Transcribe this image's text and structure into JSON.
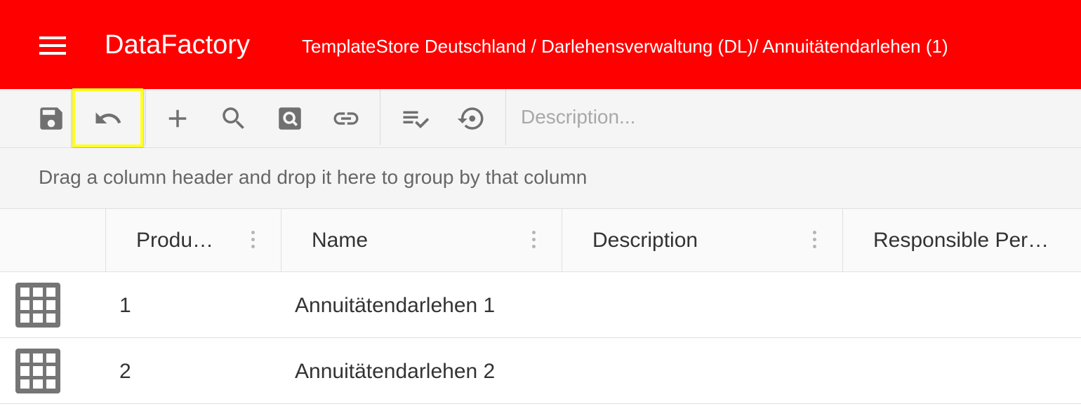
{
  "appbar": {
    "title": "DataFactory",
    "breadcrumb": "TemplateStore Deutschland / Darlehensverwaltung (DL)/ Annuitätendarlehen (1)",
    "background_color": "#ff0000",
    "menu_icon": "hamburger-menu-icon"
  },
  "toolbar": {
    "buttons": [
      {
        "name": "save",
        "icon": "save-icon"
      },
      {
        "name": "undo",
        "icon": "undo-icon",
        "highlighted": true
      },
      {
        "name": "add",
        "icon": "plus-icon"
      },
      {
        "name": "search",
        "icon": "search-icon"
      },
      {
        "name": "search-record",
        "icon": "image-search-icon"
      },
      {
        "name": "link",
        "icon": "link-icon"
      },
      {
        "name": "validate",
        "icon": "playlist-check-icon"
      },
      {
        "name": "restore",
        "icon": "history-icon"
      }
    ],
    "description_placeholder": "Description...",
    "description_value": "",
    "highlight_color": "#ffff22"
  },
  "grid": {
    "group_panel_text": "Drag a column header and drop it here to group by that column",
    "columns": [
      "Produ…",
      "Name",
      "Description",
      "Responsible Per…"
    ],
    "rows": [
      {
        "icon": "grid-table-icon",
        "cells": [
          "1",
          "Annuitätendarlehen 1",
          "",
          ""
        ]
      },
      {
        "icon": "grid-table-icon",
        "cells": [
          "2",
          "Annuitätendarlehen 2",
          "",
          ""
        ]
      }
    ]
  }
}
